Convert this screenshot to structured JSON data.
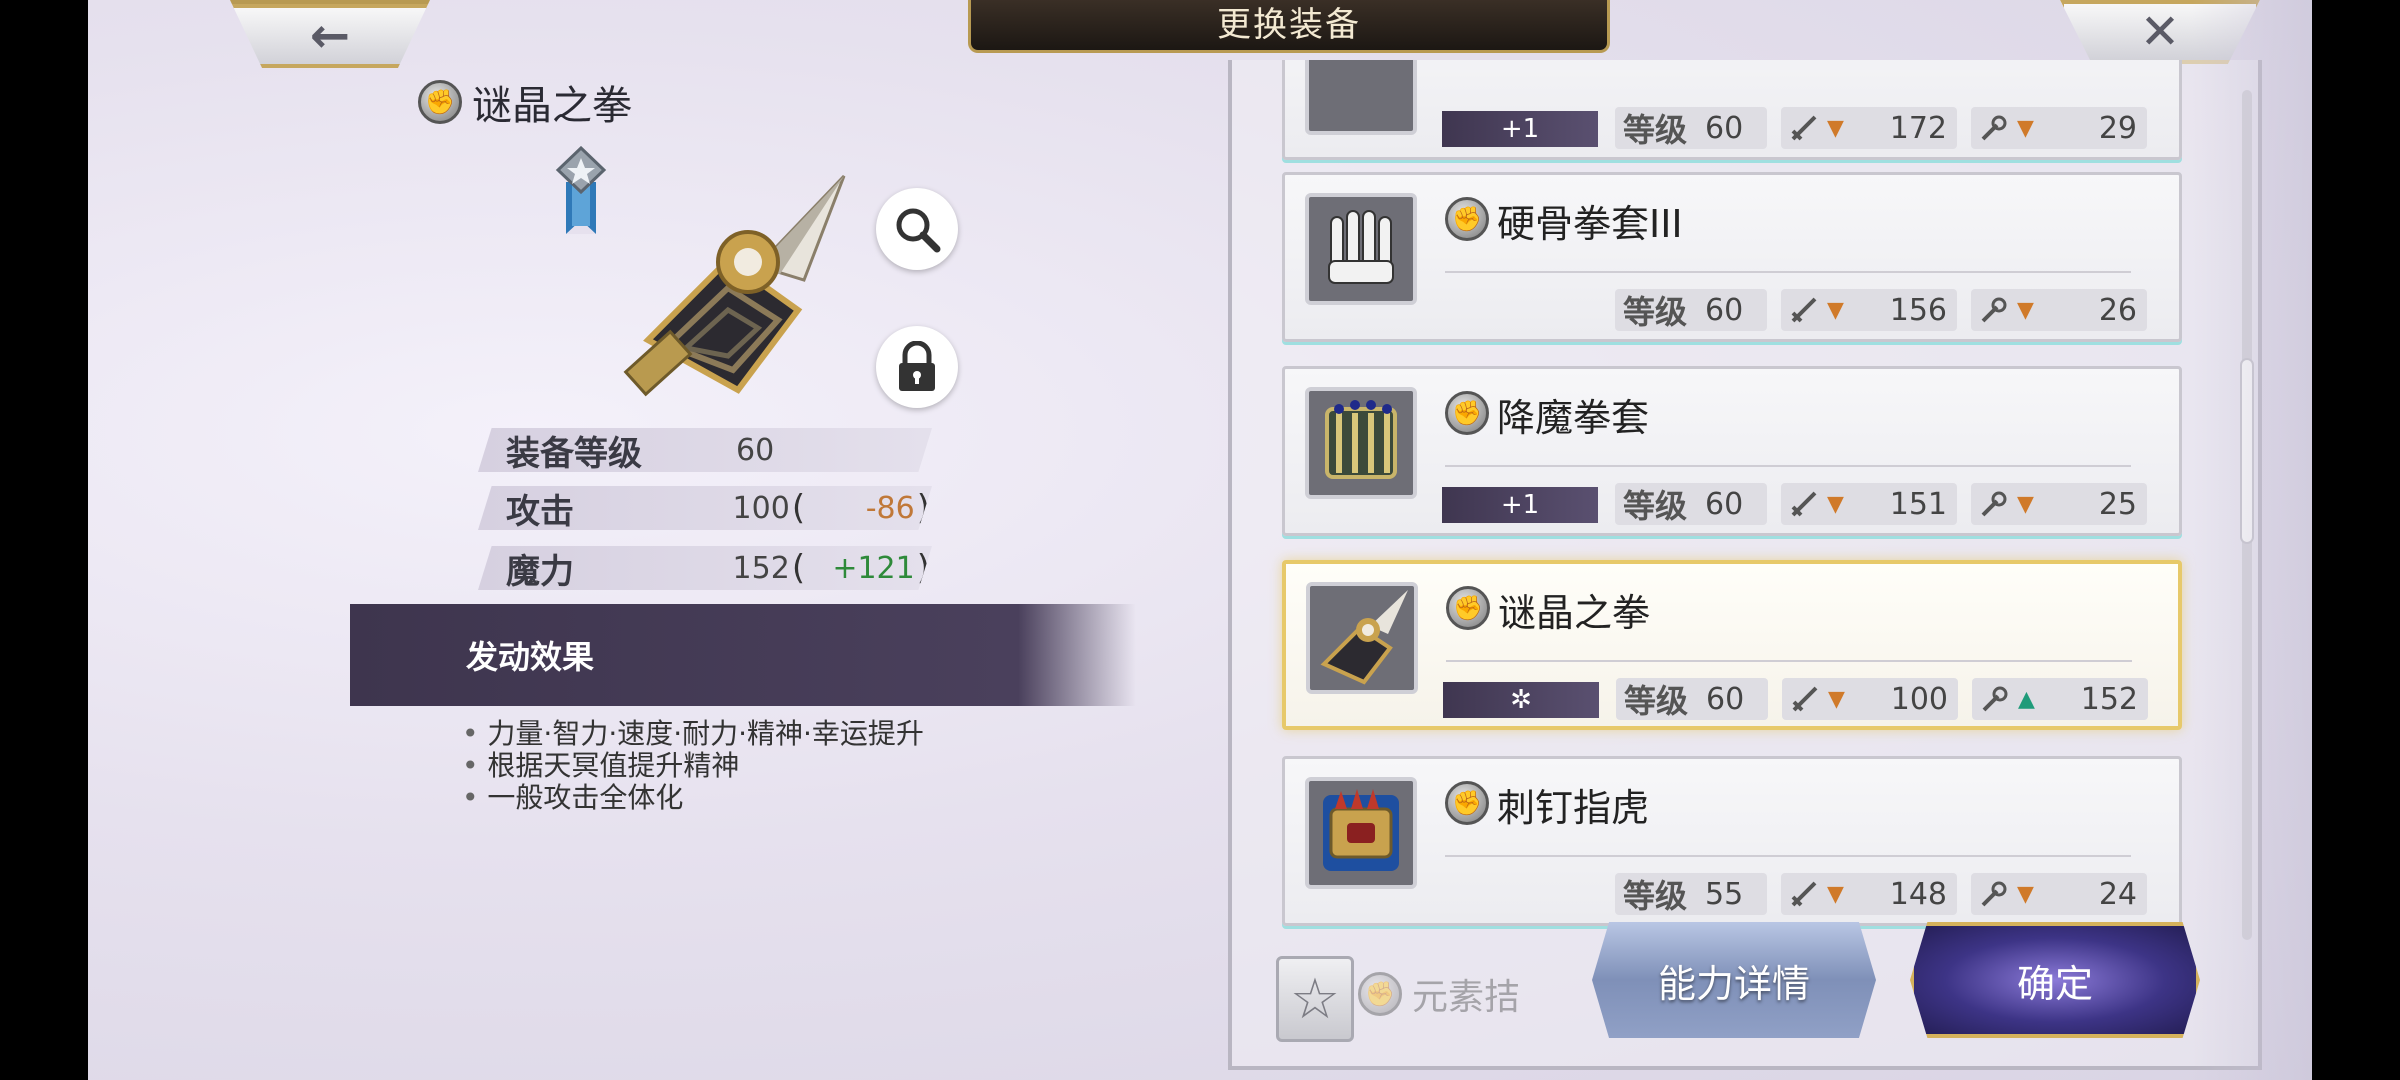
{
  "header": {
    "title": "更换装备",
    "back_icon": "←",
    "close_icon": "✕"
  },
  "detail": {
    "item_name": "谜晶之拳",
    "stats": [
      {
        "label": "装备等级",
        "value": "60",
        "diff": ""
      },
      {
        "label": "攻击",
        "value": "100",
        "diff": "-86"
      },
      {
        "label": "魔力",
        "value": "152",
        "diff": "+121"
      }
    ],
    "effect_header": "发动效果",
    "effects": [
      "力量·智力·速度·耐力·精神·幸运提升",
      "根据天冥值提升精神",
      "一般攻击全体化"
    ]
  },
  "list": {
    "items": [
      {
        "name": "",
        "refine": "+1",
        "level_label": "等级",
        "level": "60",
        "atk": "172",
        "atk_trend": "down",
        "mag": "29",
        "mag_trend": "down"
      },
      {
        "name": "硬骨拳套III",
        "refine": "",
        "level_label": "等级",
        "level": "60",
        "atk": "156",
        "atk_trend": "down",
        "mag": "26",
        "mag_trend": "down"
      },
      {
        "name": "降魔拳套",
        "refine": "+1",
        "level_label": "等级",
        "level": "60",
        "atk": "151",
        "atk_trend": "down",
        "mag": "25",
        "mag_trend": "down"
      },
      {
        "name": "谜晶之拳",
        "refine": "✲",
        "level_label": "等级",
        "level": "60",
        "atk": "100",
        "atk_trend": "down",
        "mag": "152",
        "mag_trend": "up"
      },
      {
        "name": "刺钉指虎",
        "refine": "",
        "level_label": "等级",
        "level": "55",
        "atk": "148",
        "atk_trend": "down",
        "mag": "24",
        "mag_trend": "down"
      }
    ],
    "partial_item_name": "元素拮"
  },
  "buttons": {
    "ability": "能力详情",
    "confirm": "确定",
    "favorite_icon": "☆"
  },
  "colors": {
    "panel_dark": "#3e354e",
    "gold": "#d5b25b",
    "negative": "#c07838",
    "positive": "#2e8a3a"
  }
}
